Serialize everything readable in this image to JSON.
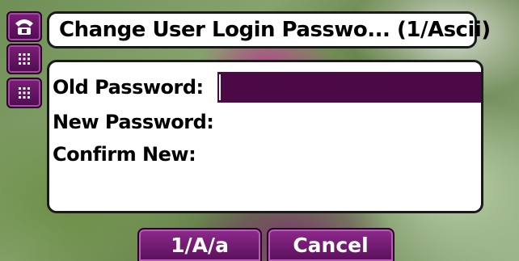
{
  "title": "Change User Login Passwo... (1/Ascii)",
  "side_keys": [
    {
      "icon": "phone-handset-icon"
    },
    {
      "icon": "keypad-icon"
    },
    {
      "icon": "keypad-icon"
    }
  ],
  "form": {
    "old_password_label": "Old Password:",
    "new_password_label": "New Password:",
    "confirm_new_label": "Confirm New:",
    "old_password_value": "",
    "new_password_value": "",
    "confirm_new_value": ""
  },
  "softkeys": {
    "input_mode_label": "1/A/a",
    "cancel_label": "Cancel"
  },
  "colors": {
    "accent": "#5a0f5b",
    "highlight": "#4b0a46"
  }
}
